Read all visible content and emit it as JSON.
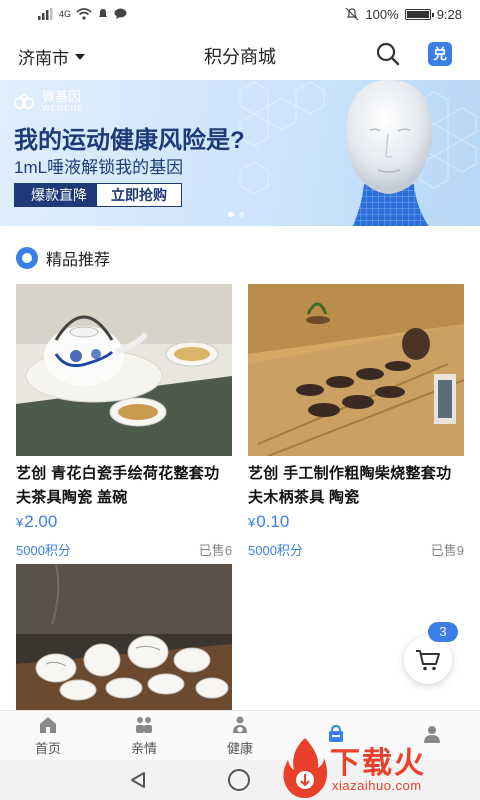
{
  "status_bar": {
    "signal_label": "4G",
    "battery_text": "100%",
    "battery_level": 1.0,
    "time": "9:28"
  },
  "header": {
    "city": "济南市",
    "title": "积分商城",
    "redeem_label": "兑"
  },
  "banner": {
    "brand_cn": "微基因",
    "brand_en": "WEGENE",
    "headline": "我的运动健康风险是?",
    "subline": "1mL唾液解锁我的基因",
    "tag_hot": "爆款直降",
    "tag_buy": "立即抢购",
    "slide_count": 2,
    "active_slide": 0
  },
  "section": {
    "title": "精品推荐"
  },
  "products": [
    {
      "name": "艺创 青花白瓷手绘荷花整套功夫茶具陶瓷 盖碗",
      "price_symbol": "¥",
      "price": "2.00",
      "points": "5000积分",
      "sold": "已售6"
    },
    {
      "name": "艺创 手工制作粗陶柴烧整套功夫木柄茶具 陶瓷",
      "price_symbol": "¥",
      "price": "0.10",
      "points": "5000积分",
      "sold": "已售9"
    },
    {
      "name": "",
      "price_symbol": "",
      "price": "",
      "points": "",
      "sold": ""
    }
  ],
  "cart": {
    "badge": "3"
  },
  "bottom_nav": [
    {
      "label": "首页",
      "icon": "home-icon",
      "active": false
    },
    {
      "label": "亲情",
      "icon": "family-icon",
      "active": false
    },
    {
      "label": "健康",
      "icon": "health-icon",
      "active": false
    },
    {
      "label": "",
      "icon": "shop-bag-icon",
      "active": true
    },
    {
      "label": "",
      "icon": "profile-icon",
      "active": false
    }
  ],
  "watermark": {
    "title": "下载火",
    "sub": "xiazaihuo.com"
  },
  "colors": {
    "accent": "#3a7fe8",
    "banner_text": "#1e3a78",
    "watermark": "#e8402a"
  }
}
